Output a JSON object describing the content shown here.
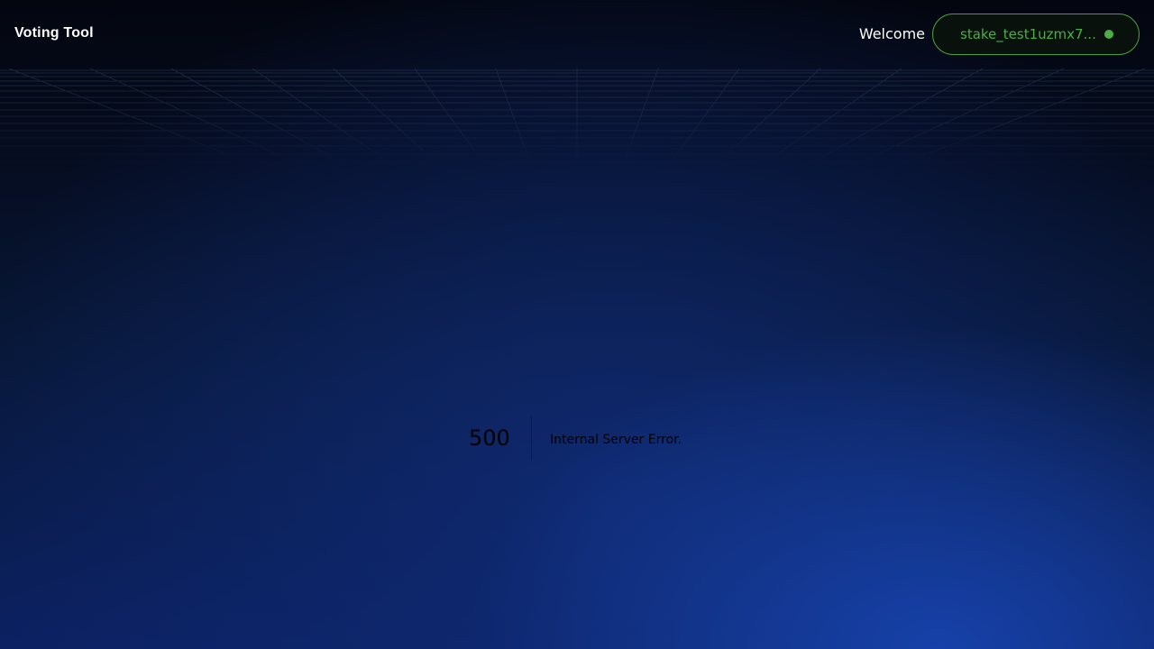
{
  "header": {
    "brand": "Voting Tool",
    "welcome": "Welcome",
    "wallet": {
      "address": "stake_test1uzmx7...",
      "status_icon": "connected-dot-icon",
      "accent_color": "#4cae45"
    }
  },
  "error": {
    "code": "500",
    "message": "Internal Server Error."
  }
}
